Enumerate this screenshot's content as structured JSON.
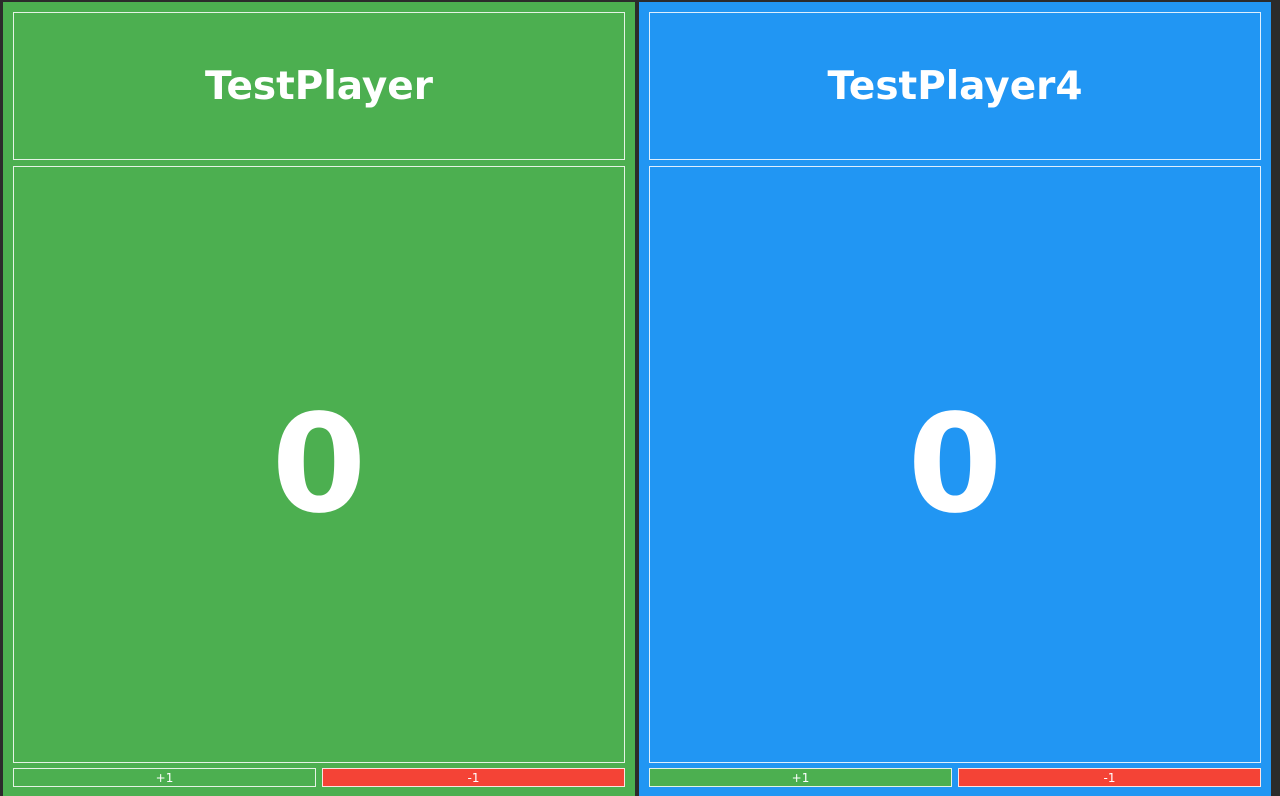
{
  "players": [
    {
      "name": "TestPlayer",
      "score": "0",
      "color": "#4caf50",
      "increment_label": "+1",
      "decrement_label": "-1"
    },
    {
      "name": "TestPlayer4",
      "score": "0",
      "color": "#2196f3",
      "increment_label": "+1",
      "decrement_label": "-1"
    }
  ],
  "colors": {
    "background": "#2b2b2b",
    "increment_button": "#4caf50",
    "decrement_button": "#f44336",
    "text": "#ffffff"
  }
}
